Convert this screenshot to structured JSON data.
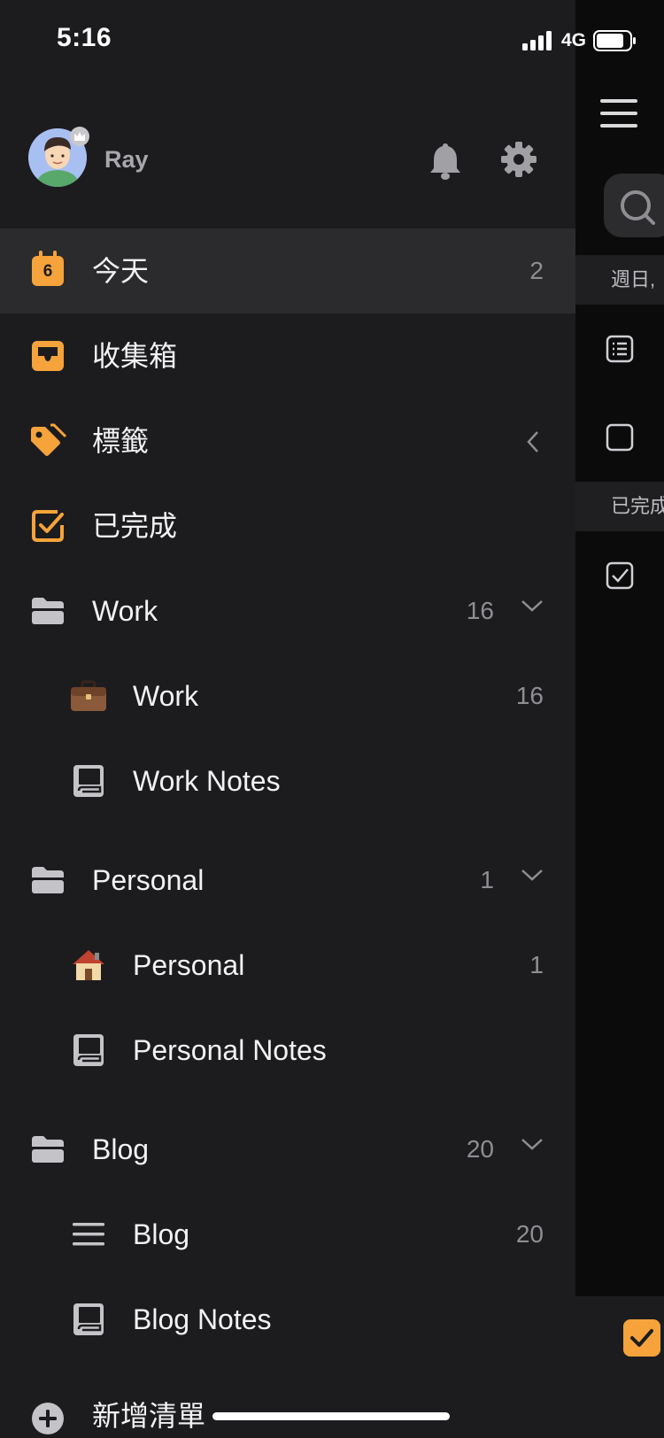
{
  "status_bar": {
    "time": "5:16",
    "network": "4G"
  },
  "profile": {
    "name": "Ray"
  },
  "nav": {
    "today": {
      "label": "今天",
      "count": "2",
      "day": "6"
    },
    "inbox": {
      "label": "收集箱"
    },
    "tags": {
      "label": "標籤"
    },
    "completed": {
      "label": "已完成"
    }
  },
  "folders": [
    {
      "label": "Work",
      "count": "16",
      "lists": [
        {
          "label": "Work",
          "count": "16",
          "icon": "briefcase-icon"
        },
        {
          "label": "Work Notes",
          "count": "",
          "icon": "notes-icon"
        }
      ]
    },
    {
      "label": "Personal",
      "count": "1",
      "lists": [
        {
          "label": "Personal",
          "count": "1",
          "icon": "house-icon"
        },
        {
          "label": "Personal Notes",
          "count": "",
          "icon": "notes-icon"
        }
      ]
    },
    {
      "label": "Blog",
      "count": "20",
      "lists": [
        {
          "label": "Blog",
          "count": "20",
          "icon": "list-icon"
        },
        {
          "label": "Blog Notes",
          "count": "",
          "icon": "notes-icon"
        }
      ]
    }
  ],
  "add_list": {
    "label": "新增清單"
  },
  "background_screen": {
    "section_date": "週日,",
    "section_completed": "已完成"
  },
  "colors": {
    "accent": "#f5a33a",
    "drawer_bg": "#1c1c1e",
    "active_row": "#2b2b2d",
    "muted_text": "#8e8e93"
  }
}
